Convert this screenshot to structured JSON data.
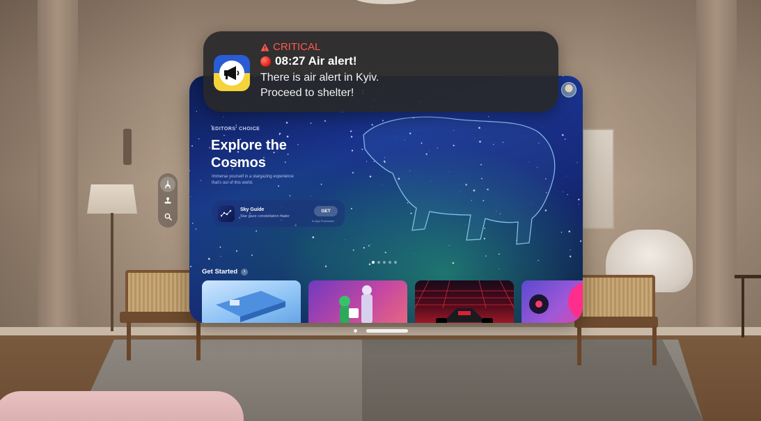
{
  "notification": {
    "severity_label": "CRITICAL",
    "severity_icon": "warning-triangle-icon",
    "status_icon": "red-circle-icon",
    "title": "08:27 Air alert!",
    "body_line_1": "There is air alert in Kyiv.",
    "body_line_2": "Proceed to shelter!",
    "app_icon": "megaphone-icon",
    "colors": {
      "severity": "#ff5a4e",
      "background": "#28282a"
    }
  },
  "ornament": {
    "items": [
      {
        "name": "apps",
        "icon": "app-store-icon",
        "active": true
      },
      {
        "name": "arcade",
        "icon": "arcade-icon",
        "active": false
      },
      {
        "name": "search",
        "icon": "search-icon",
        "active": false
      }
    ]
  },
  "hero": {
    "eyebrow": "EDITORS' CHOICE",
    "title": "Explore the Cosmos",
    "description": "Immerse yourself in a stargazing experience that's out of this world.",
    "promo": {
      "app_name": "Sky Guide",
      "subtitle": "Star gaze constellation finder",
      "get_label": "GET",
      "note": "In-App Purchases"
    },
    "page_dots": {
      "count": 5,
      "selected_index": 0
    }
  },
  "get_started": {
    "title": "Get Started",
    "items": [
      {
        "name": "puzzle-game"
      },
      {
        "name": "chess-game"
      },
      {
        "name": "racing-game"
      },
      {
        "name": "music-app"
      }
    ]
  }
}
